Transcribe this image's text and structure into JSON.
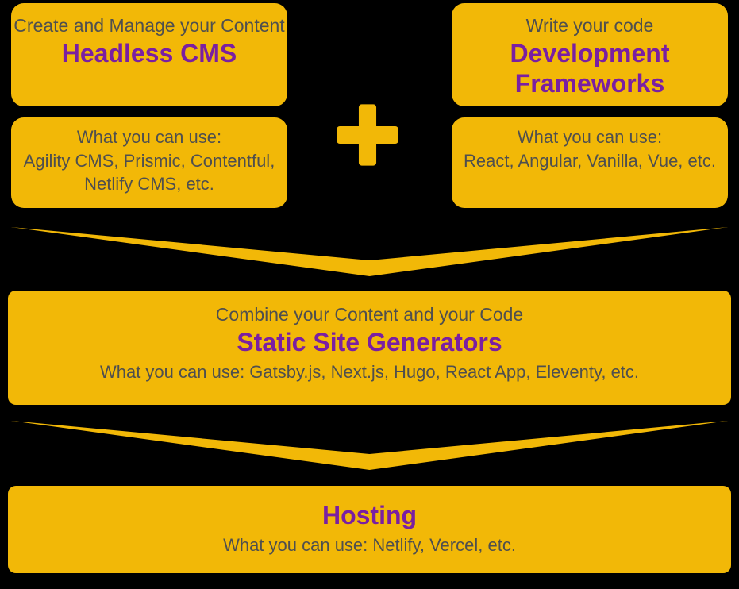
{
  "colors": {
    "background": "#000000",
    "boxFill": "#F2B807",
    "titleText": "#7A1FA2",
    "bodyText": "#4F4F4F"
  },
  "cms": {
    "subtitle": "Create and Manage your Content",
    "title": "Headless CMS",
    "usageLabel": "What you can use:",
    "usageList": "Agility CMS, Prismic, Contentful, Netlify CMS, etc."
  },
  "dev": {
    "subtitle": "Write your code",
    "title": "Development Frameworks",
    "usageLabel": "What you can use:",
    "usageList": "React, Angular, Vanilla, Vue, etc."
  },
  "combineIcon": "plus-icon",
  "ssg": {
    "subtitle": "Combine your Content and your Code",
    "title": "Static Site Generators",
    "usage": "What you can use: Gatsby.js, Next.js, Hugo, React App, Eleventy, etc."
  },
  "hosting": {
    "title": "Hosting",
    "usage": "What you can use: Netlify, Vercel, etc."
  }
}
